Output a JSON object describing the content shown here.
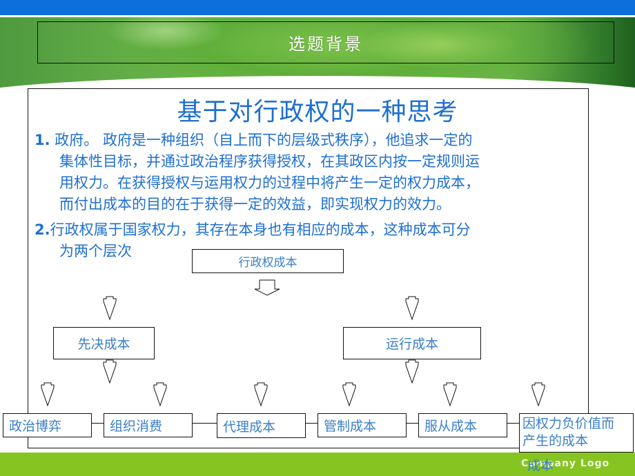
{
  "slide": {
    "section_title": "选题背景",
    "heading": "基于对行政权的一种思考",
    "points": [
      {
        "number": "1.",
        "lines": [
          " 政府。 政府是一种组织（自上而下的层级式秩序），他追求一定的",
          "集体性目标，并通过政治程序获得授权，在其政区内按一定规则运",
          "用权力。在获得授权与运用权力的过程中将产生一定的权力成本，",
          "而付出成本的目的在于获得一定的效益，即实现权力的效力。"
        ]
      },
      {
        "number": "2.",
        "lines": [
          "行政权属于国家权力，其存在本身也有相应的成本，这种成本可分",
          "为两个层次"
        ]
      }
    ]
  },
  "diagram": {
    "root": "行政权成本",
    "level1": [
      "先决成本",
      "运行成本"
    ],
    "level2": [
      "政治博弈",
      "组织消费",
      "代理成本",
      "管制成本",
      "服从成本",
      "因权力负价值而产生的成本"
    ],
    "overflow_text": "成本"
  },
  "footer": {
    "logo_text": "Company Logo"
  },
  "colors": {
    "top_bar": "#0b6fdc",
    "text_blue": "#1e6fd1",
    "box_text": "#3a7fc8",
    "footer_green": "#86c521"
  }
}
